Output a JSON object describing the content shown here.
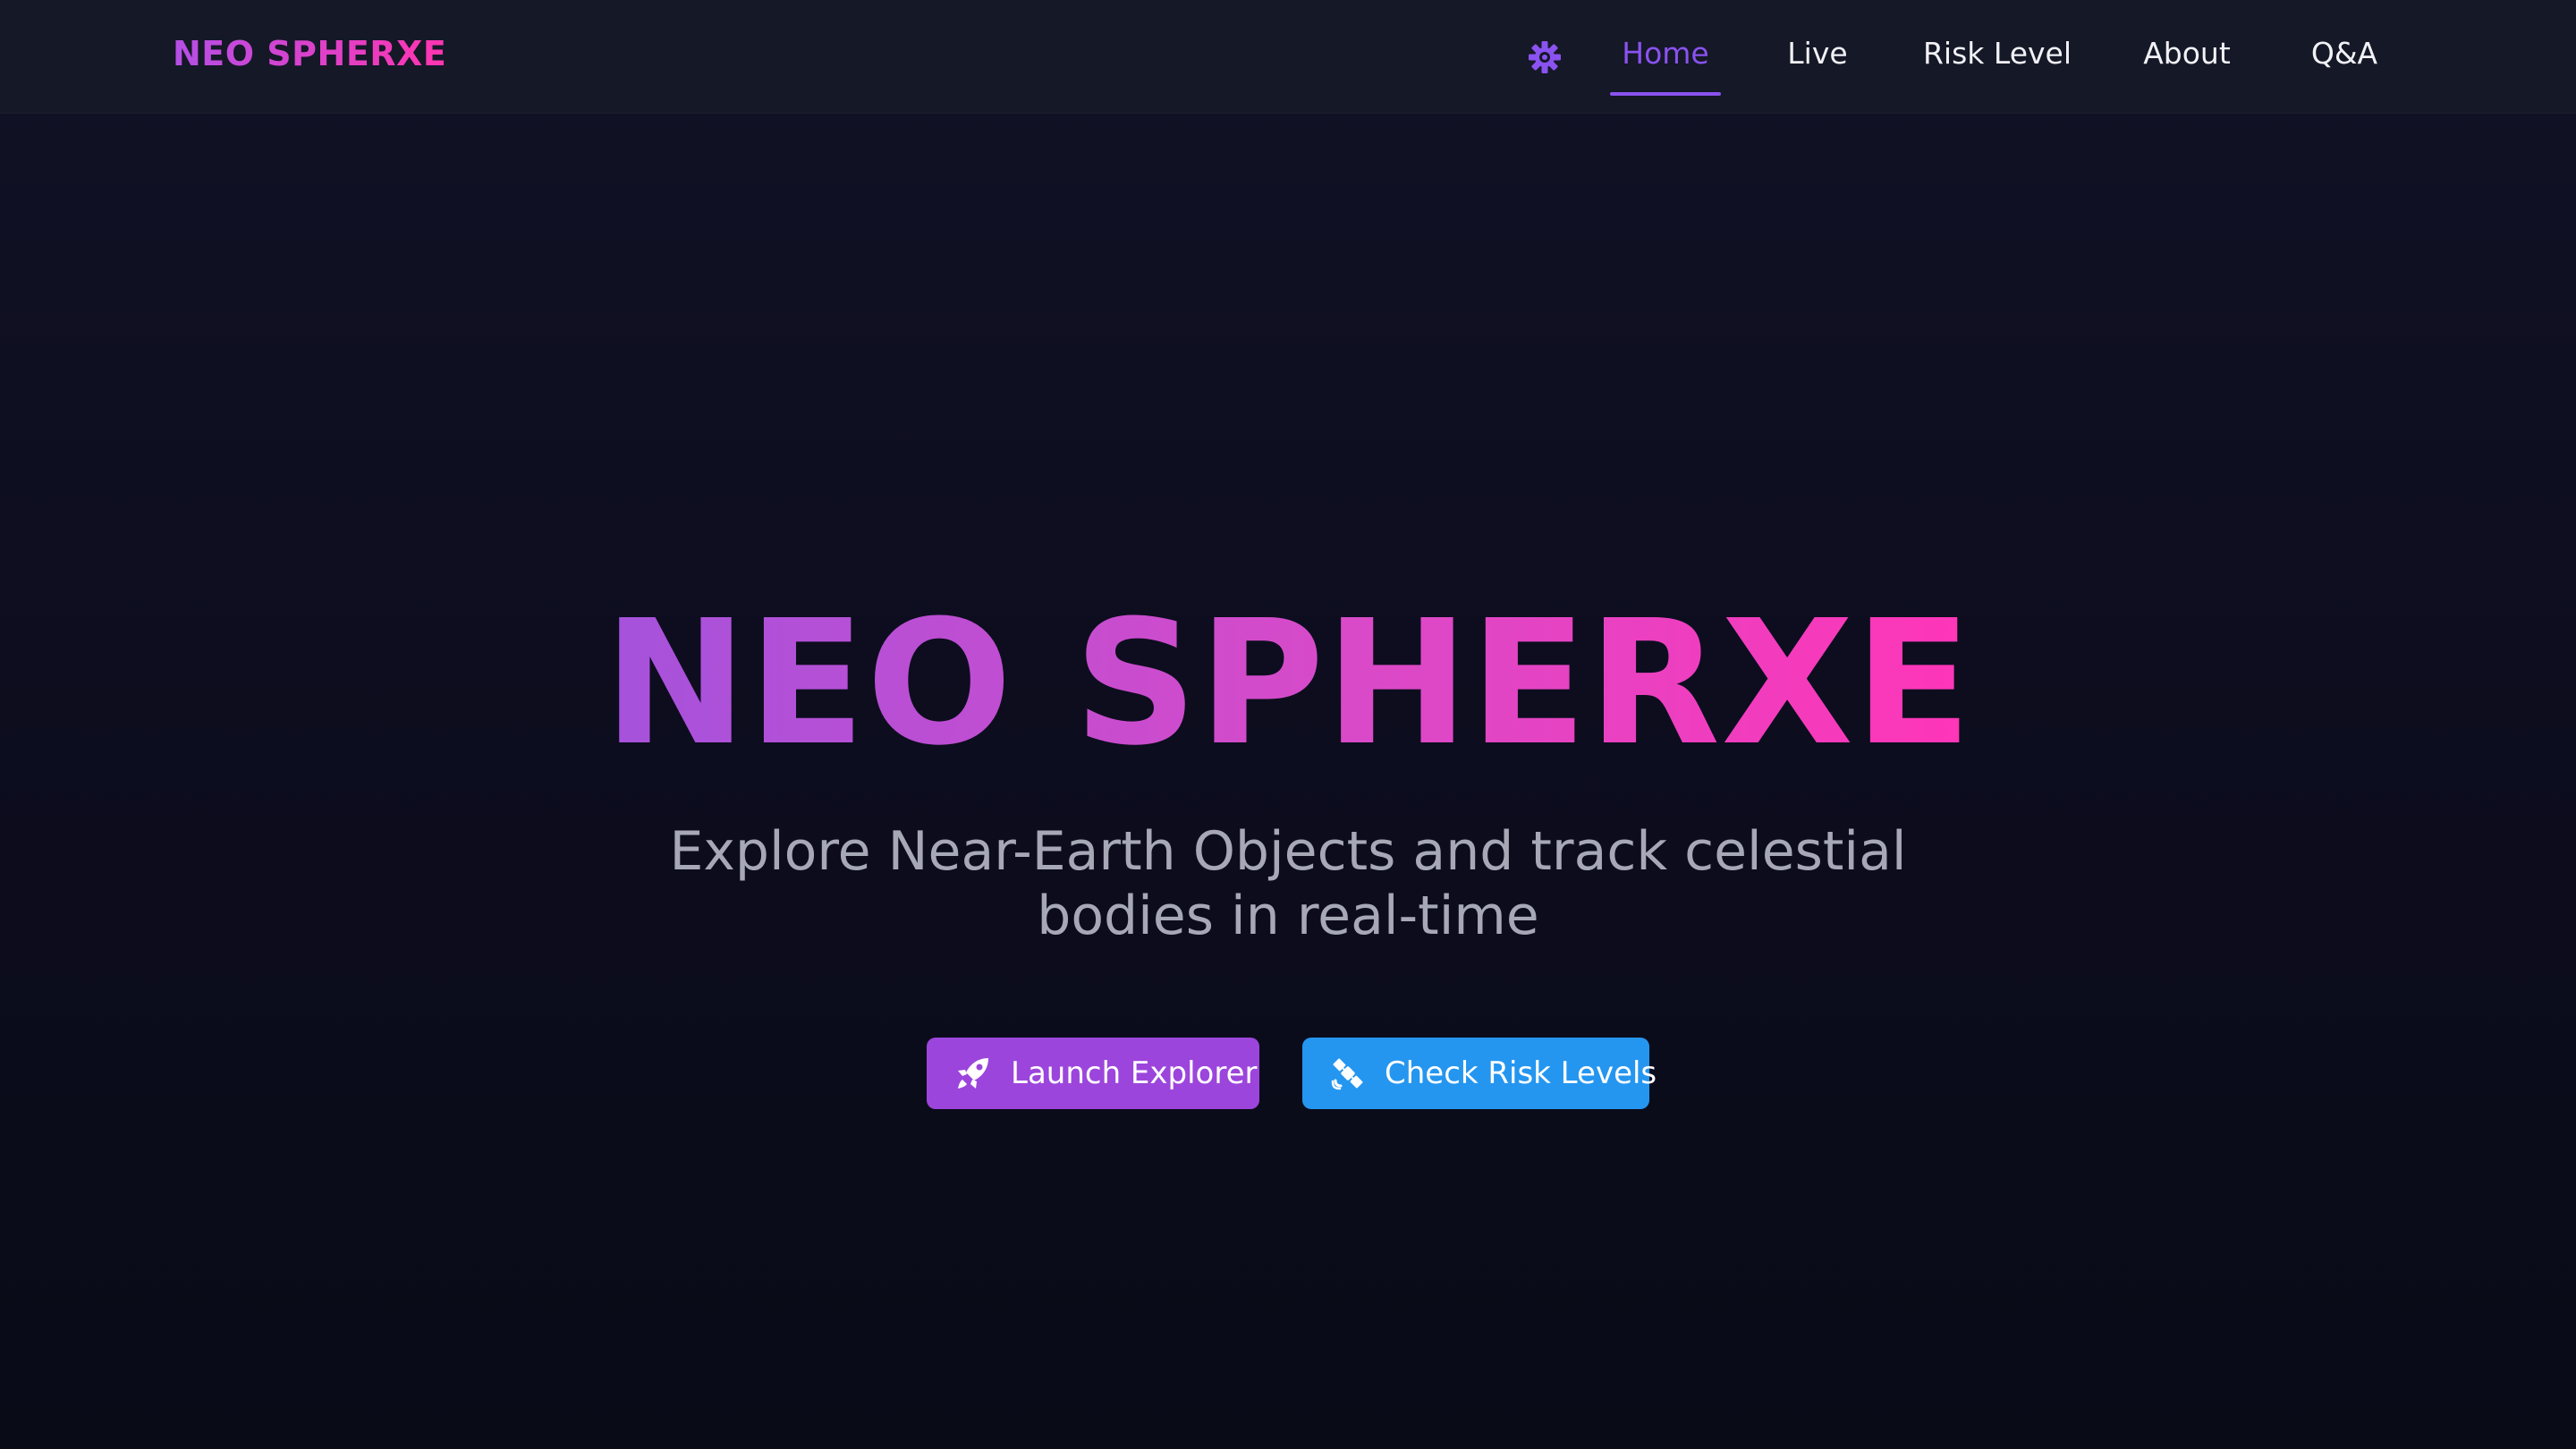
{
  "navbar": {
    "brand": "NEO SPHERXE",
    "theme_icon": "gear-icon",
    "items": [
      {
        "label": "Home",
        "active": true
      },
      {
        "label": "Live",
        "active": false
      },
      {
        "label": "Risk Level",
        "active": false
      },
      {
        "label": "About",
        "active": false
      },
      {
        "label": "Q&A",
        "active": false
      }
    ]
  },
  "hero": {
    "title": "NEO SPHERXE",
    "subtitle": "Explore Near-Earth Objects and track celestial bodies in real-time",
    "buttons": {
      "launch": {
        "label": "Launch Explorer",
        "icon": "rocket-icon"
      },
      "risk": {
        "label": "Check Risk Levels",
        "icon": "satellite-icon"
      }
    }
  },
  "colors": {
    "accent_purple": "#8a52f0",
    "button_purple": "#9c45dc",
    "button_blue": "#2496f0",
    "gradient_start": "#a552dc",
    "gradient_end": "#ff35b8",
    "background": "#0c0c1a"
  }
}
